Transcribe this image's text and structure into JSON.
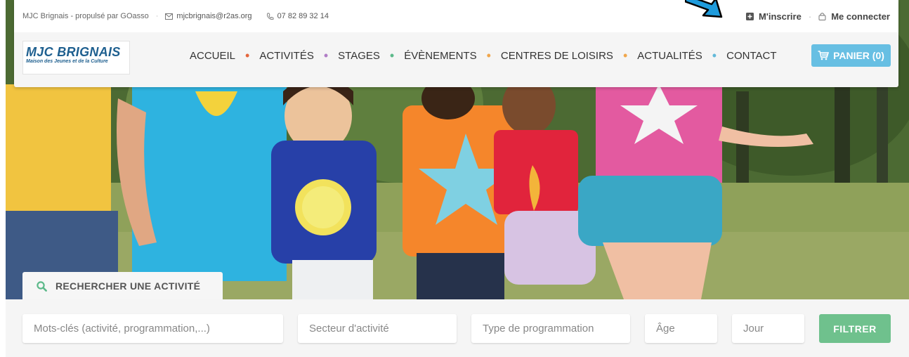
{
  "topbar": {
    "site": "MJC Brignais - propulsé par GOasso",
    "email": "mjcbrignais@r2as.org",
    "phone": "07 82 89 32 14",
    "register": "M'inscrire",
    "login": "Me connecter"
  },
  "logo": {
    "name": "MJC BRIGNAIS",
    "tagline": "Maison des Jeunes et de la Culture"
  },
  "menu": {
    "items": [
      "ACCUEIL",
      "ACTIVITÉS",
      "STAGES",
      "ÉVÈNEMENTS",
      "CENTRES DE LOISIRS",
      "ACTUALITÉS",
      "CONTACT"
    ],
    "dot_colors": [
      "#e4663c",
      "#b07cc6",
      "#5cb98a",
      "#f0a64b",
      "#f0a64b",
      "#63b9d9"
    ]
  },
  "cart": {
    "label": "PANIER (0)"
  },
  "search": {
    "tab_label": "RECHERCHER UNE ACTIVITÉ",
    "keywords_placeholder": "Mots-clés (activité, programmation,...)",
    "sector_placeholder": "Secteur d'activité",
    "programming_placeholder": "Type de programmation",
    "age_placeholder": "Âge",
    "day_placeholder": "Jour",
    "filter_button": "FILTRER"
  },
  "colors": {
    "accent_blue": "#67bfe3",
    "filter_green": "#6fc18d",
    "search_icon": "#5cb98a",
    "logo_blue": "#1e5f8f"
  }
}
